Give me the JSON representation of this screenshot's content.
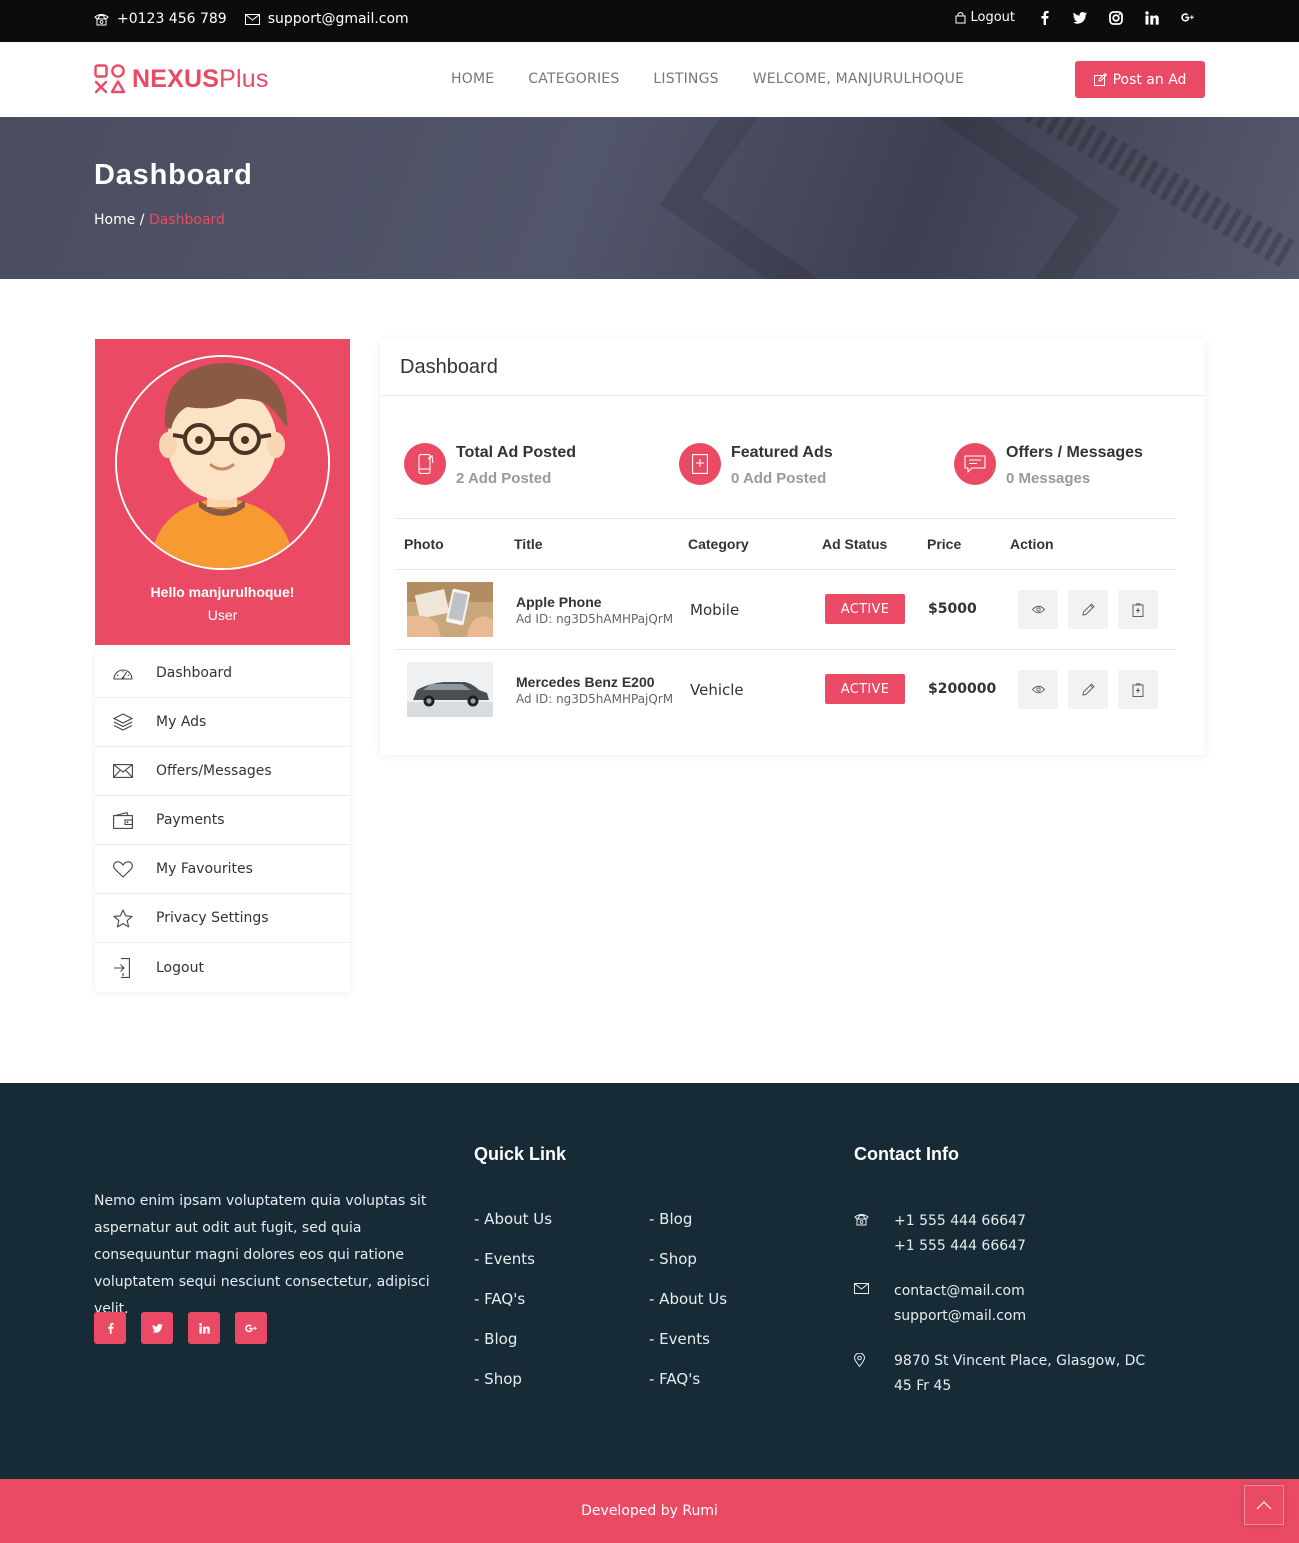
{
  "topbar": {
    "phone": "+0123 456 789",
    "email": "support@gmail.com",
    "logout": "Logout",
    "social_icons": [
      "facebook-icon",
      "twitter-icon",
      "instagram-icon",
      "linkedin-icon",
      "google-plus-icon"
    ]
  },
  "header": {
    "logo_bold": "NEXUS",
    "logo_light": "Plus",
    "nav": [
      "HOME",
      "CATEGORIES",
      "LISTINGS",
      "WELCOME, MANJURULHOQUE"
    ],
    "post_ad": "Post an Ad"
  },
  "banner": {
    "title": "Dashboard",
    "breadcrumb_home": "Home /",
    "breadcrumb_active": "Dashboard"
  },
  "profile": {
    "hello": "Hello manjurulhoque!",
    "role": "User"
  },
  "sidebar": {
    "items": [
      {
        "label": "Dashboard",
        "icon": "dashboard-gauge-icon"
      },
      {
        "label": "My Ads",
        "icon": "layers-icon"
      },
      {
        "label": "Offers/Messages",
        "icon": "envelope-icon"
      },
      {
        "label": "Payments",
        "icon": "wallet-icon"
      },
      {
        "label": "My Favourites",
        "icon": "heart-icon"
      },
      {
        "label": "Privacy Settings",
        "icon": "star-icon"
      },
      {
        "label": "Logout",
        "icon": "logout-icon"
      }
    ]
  },
  "dashboard": {
    "title": "Dashboard",
    "stats": [
      {
        "label": "Total Ad Posted",
        "value": "2 Add Posted"
      },
      {
        "label": "Featured Ads",
        "value": "0 Add Posted"
      },
      {
        "label": "Offers / Messages",
        "value": "0 Messages"
      }
    ],
    "columns": [
      "Photo",
      "Title",
      "Category",
      "Ad Status",
      "Price",
      "Action"
    ],
    "rows": [
      {
        "title": "Apple Phone",
        "ad_id": "Ad ID: ng3D5hAMHPajQrM",
        "category": "Mobile",
        "status": "ACTIVE",
        "price": "$5000"
      },
      {
        "title": "Mercedes Benz E200",
        "ad_id": "Ad ID: ng3D5hAMHPajQrM",
        "category": "Vehicle",
        "status": "ACTIVE",
        "price": "$200000"
      }
    ]
  },
  "footer": {
    "about": "Nemo enim ipsam voluptatem quia voluptas sit aspernatur aut odit aut fugit, sed quia consequuntur magni dolores eos qui ratione voluptatem sequi nesciunt consectetur, adipisci velit.",
    "quick_link_title": "Quick Link",
    "links_col1": [
      "- About Us",
      "- Events",
      "- FAQ's",
      "- Blog",
      "- Shop"
    ],
    "links_col2": [
      "- Blog",
      "- Shop",
      "- About Us",
      "- Events",
      "- FAQ's"
    ],
    "contact_title": "Contact Info",
    "phone1": "+1 555 444 66647",
    "phone2": "+1 555 444 66647",
    "email1": "contact@mail.com",
    "email2": "support@mail.com",
    "address": "9870 St Vincent Place, Glasgow, DC 45 Fr 45",
    "copyright": "Developed by Rumi"
  },
  "colors": {
    "accent": "#ea4a64",
    "footer_bg": "#172b36",
    "topbar_bg": "#0c0c0c"
  }
}
